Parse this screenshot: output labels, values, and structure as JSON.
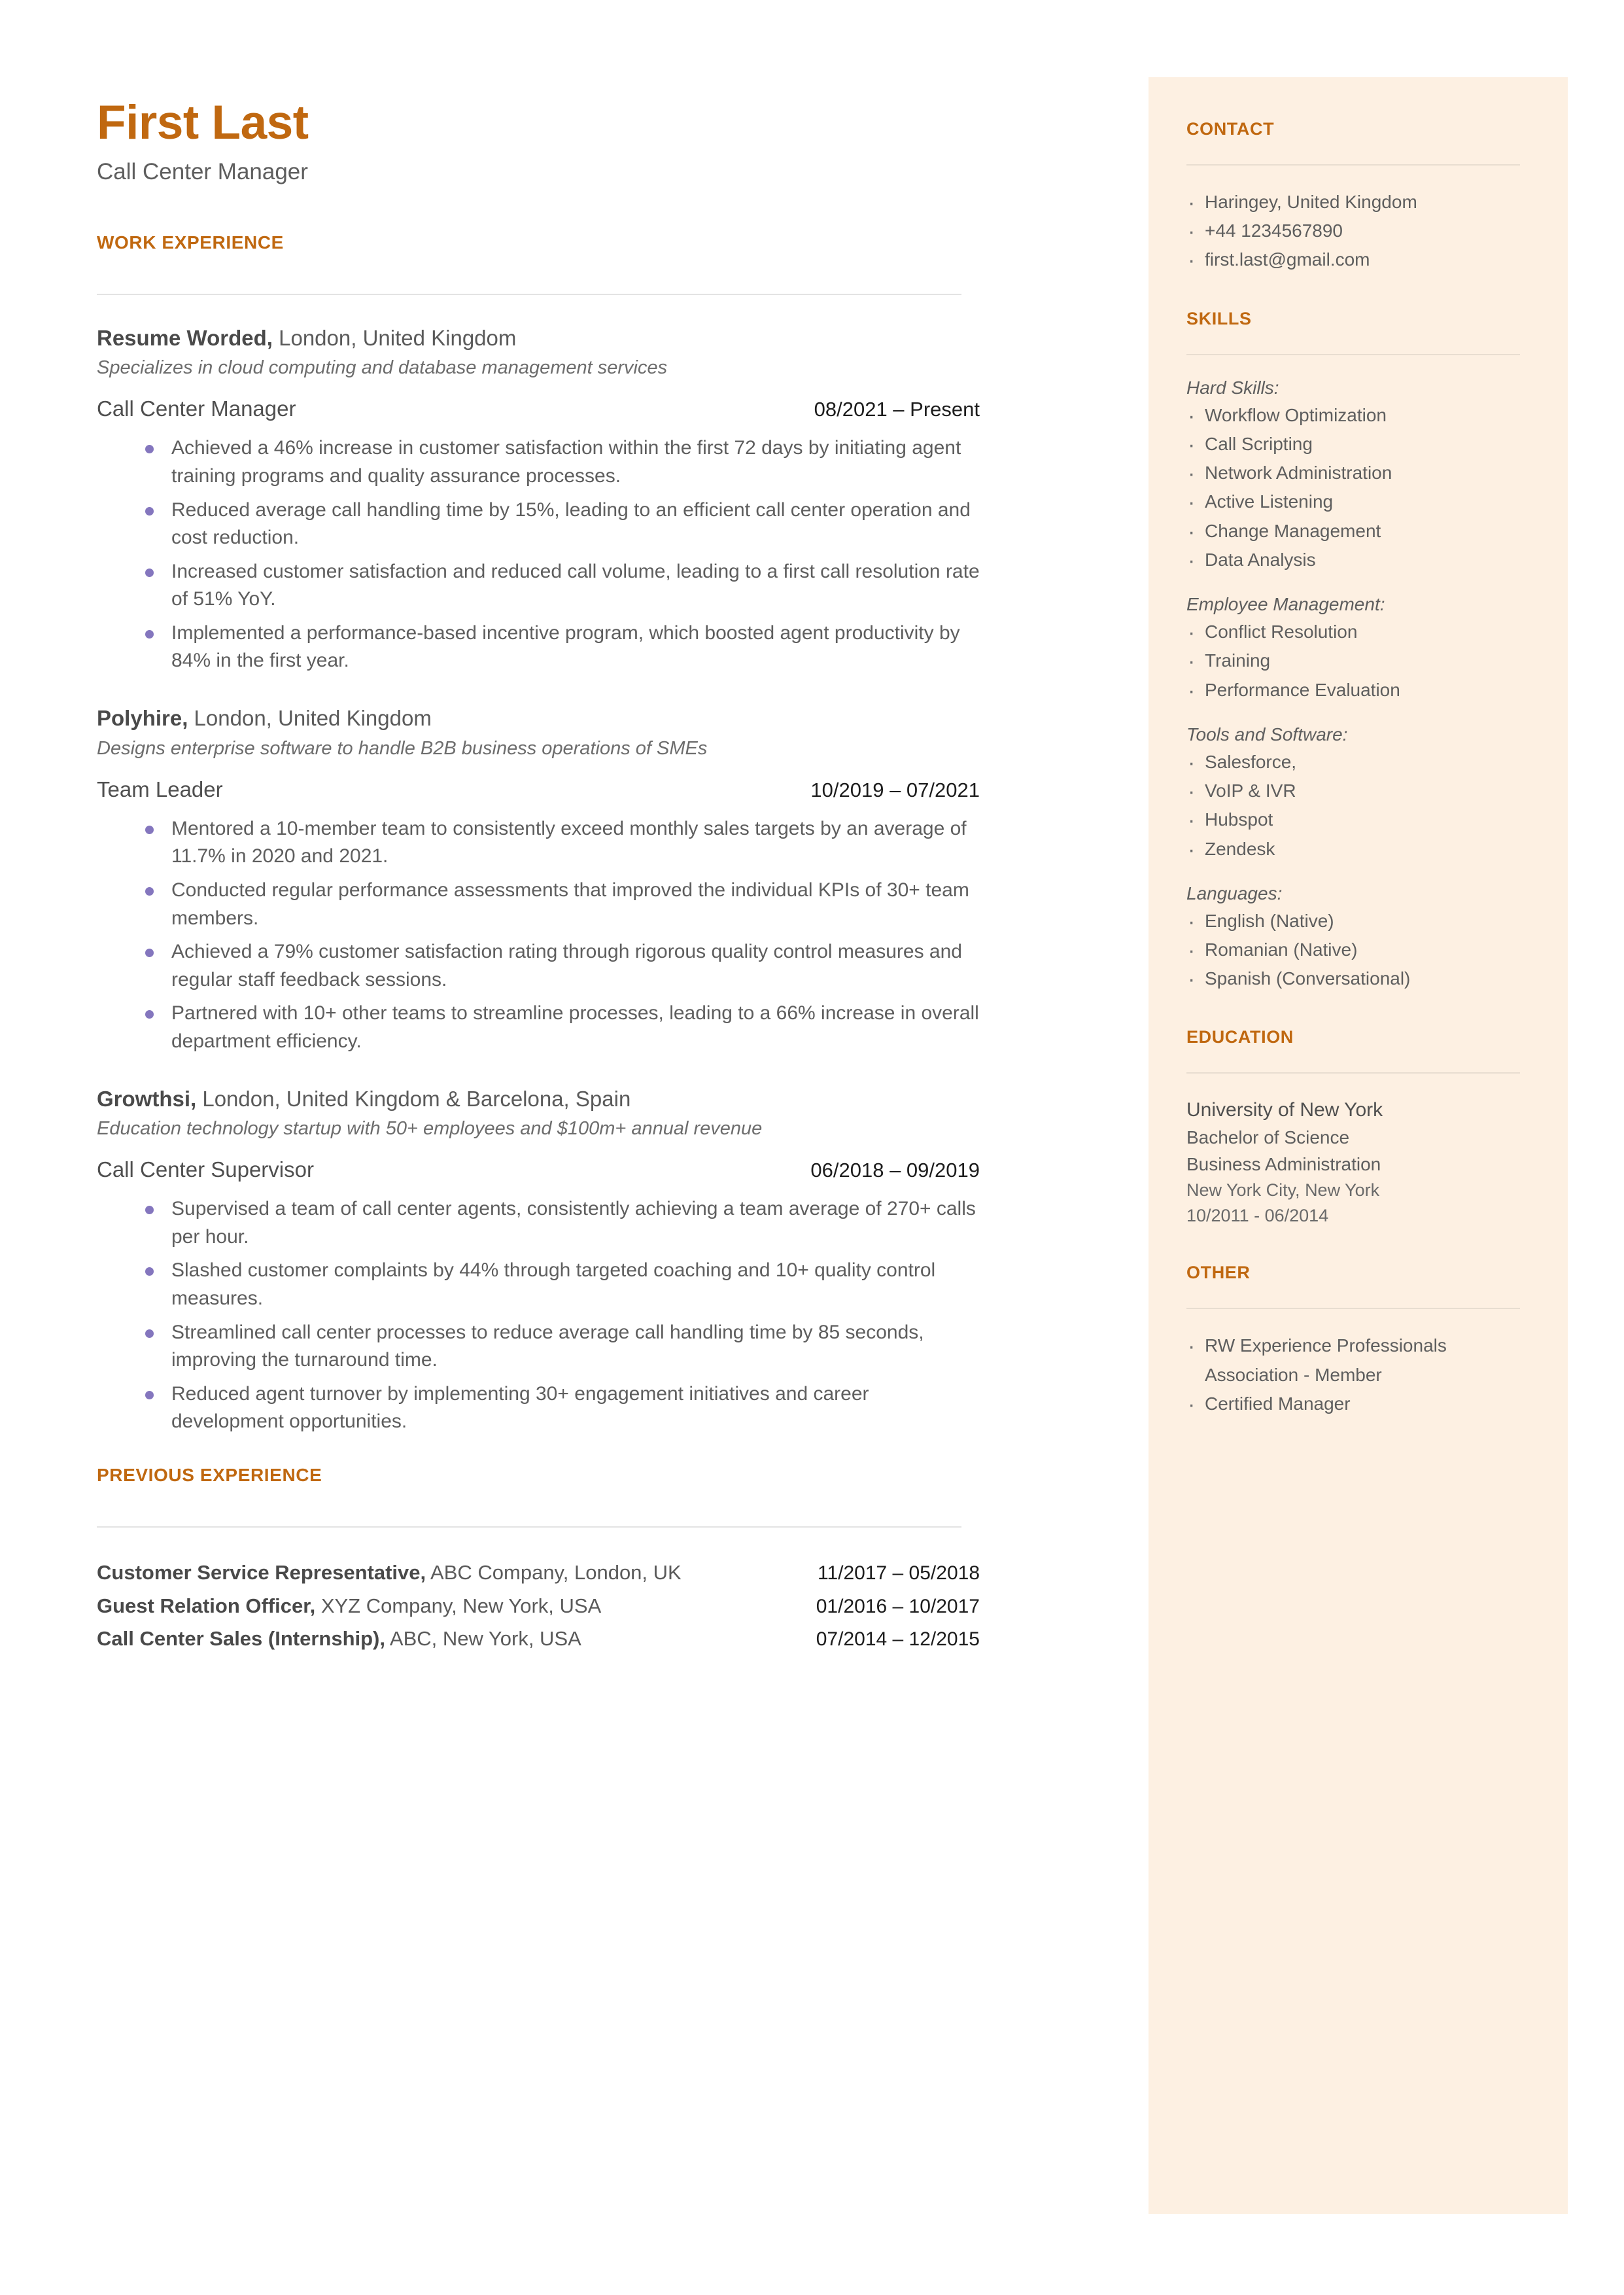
{
  "colors": {
    "accent": "#C06810",
    "sidebar_bg": "#FDF0E2",
    "body_text": "#5e5e5e",
    "bullet": "#8476BE",
    "rule": "#e3e3e3"
  },
  "header": {
    "name": "First Last",
    "title": "Call Center Manager"
  },
  "work_experience": {
    "heading": "WORK EXPERIENCE",
    "jobs": [
      {
        "company": "Resume Worded,",
        "location": " London, United Kingdom",
        "description": "Specializes in cloud computing and database management services",
        "title": "Call Center Manager",
        "dates": "08/2021 – Present",
        "bullets": [
          "Achieved a 46% increase in customer satisfaction within the first 72 days by initiating agent training programs and quality assurance processes.",
          "Reduced average call handling time by 15%, leading to an efficient call center operation and cost reduction.",
          "Increased customer satisfaction and reduced call volume, leading to a first call resolution rate of 51% YoY.",
          "Implemented a performance-based incentive program, which boosted agent productivity by 84% in the first year."
        ]
      },
      {
        "company": "Polyhire,",
        "location": " London, United Kingdom",
        "description": "Designs enterprise software to handle B2B business operations of SMEs",
        "title": "Team Leader",
        "dates": "10/2019 – 07/2021",
        "bullets": [
          "Mentored a 10-member team to consistently exceed monthly sales targets by an average of 11.7% in 2020 and 2021.",
          "Conducted regular performance assessments that improved the individual KPIs of 30+ team members.",
          "Achieved a 79% customer satisfaction rating through rigorous quality control measures and regular staff feedback sessions.",
          "Partnered with 10+ other teams to streamline processes, leading to a 66% increase in overall department efficiency."
        ]
      },
      {
        "company": "Growthsi,",
        "location": " London, United Kingdom & Barcelona, Spain",
        "description": "Education technology startup with 50+ employees and $100m+ annual revenue",
        "title": "Call Center Supervisor",
        "dates": "06/2018 – 09/2019",
        "bullets": [
          "Supervised a team of call center agents, consistently achieving a team average of 270+ calls per hour.",
          "Slashed customer complaints by 44% through targeted coaching and 10+ quality control measures.",
          "Streamlined call center processes to reduce average call handling time by 85 seconds, improving the turnaround time.",
          "Reduced agent turnover by implementing 30+ engagement initiatives and career development opportunities."
        ]
      }
    ]
  },
  "previous_experience": {
    "heading": "PREVIOUS EXPERIENCE",
    "rows": [
      {
        "role": "Customer Service Representative,",
        "detail": " ABC Company, London, UK",
        "dates": "11/2017 – 05/2018"
      },
      {
        "role": "Guest Relation Officer,",
        "detail": " XYZ Company, New York, USA",
        "dates": "01/2016 – 10/2017"
      },
      {
        "role": "Call Center Sales (Internship),",
        "detail": " ABC, New York, USA",
        "dates": "07/2014 – 12/2015"
      }
    ]
  },
  "sidebar": {
    "contact": {
      "heading": "CONTACT",
      "items": [
        "Haringey, United Kingdom",
        "+44 1234567890",
        "first.last@gmail.com"
      ]
    },
    "skills": {
      "heading": "SKILLS",
      "groups": [
        {
          "label": "Hard Skills:",
          "items": [
            "Workflow Optimization",
            "Call Scripting",
            "Network Administration",
            "Active Listening",
            "Change Management",
            "Data Analysis"
          ]
        },
        {
          "label": "Employee Management:",
          "items": [
            "Conflict Resolution",
            "Training",
            "Performance Evaluation"
          ]
        },
        {
          "label": "Tools and Software:",
          "items": [
            "Salesforce,",
            "VoIP & IVR",
            "Hubspot",
            "Zendesk"
          ]
        },
        {
          "label": "Languages:",
          "items": [
            "English (Native)",
            "Romanian (Native)",
            "Spanish (Conversational)"
          ]
        }
      ]
    },
    "education": {
      "heading": "EDUCATION",
      "school": "University of New York",
      "degree": "Bachelor of Science",
      "field": "Business Administration",
      "location": "New York City, New York",
      "dates": "10/2011 - 06/2014"
    },
    "other": {
      "heading": "OTHER",
      "items": [
        "RW Experience Professionals Association - Member",
        "Certified Manager"
      ]
    }
  }
}
